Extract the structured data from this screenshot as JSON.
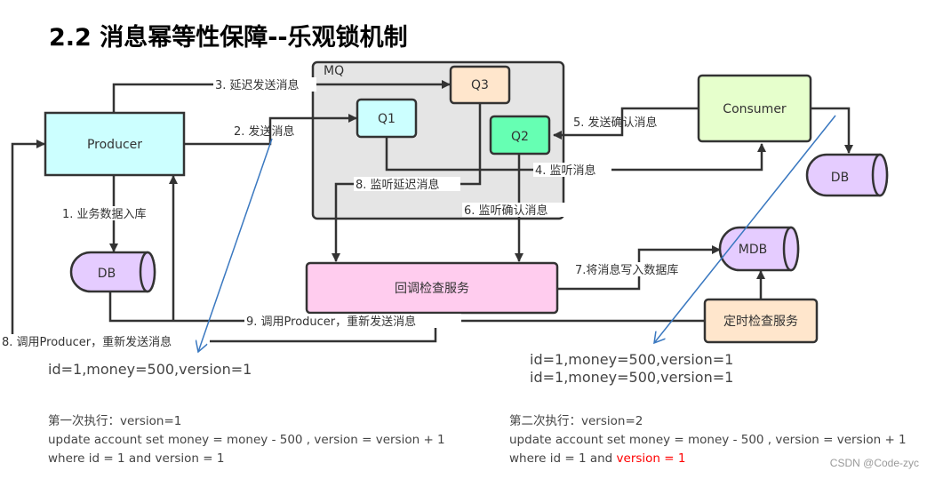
{
  "title": "2.2 消息幂等性保障--乐观锁机制",
  "nodes": {
    "producer": "Producer",
    "consumer": "Consumer",
    "mq": "MQ",
    "q1": "Q1",
    "q2": "Q2",
    "q3": "Q3",
    "db_left": "DB",
    "db_right": "DB",
    "mdb": "MDB",
    "callback_service": "回调检查服务",
    "timer_service": "定时检查服务"
  },
  "edges": {
    "e1": "1. 业务数据入库",
    "e2": "2. 发送消息",
    "e3": "3. 延迟发送消息",
    "e4": "4. 监听消息",
    "e5": "5. 发送确认消息",
    "e6": "6. 监听确认消息",
    "e7": "7.将消息写入数据库",
    "e8a": "8. 监听延迟消息",
    "e8b": "8. 调用Producer，重新发送消息",
    "e9": "9. 调用Producer，重新发送消息"
  },
  "records": {
    "left": [
      "id=1,money=500,version=1"
    ],
    "right": [
      "id=1,money=500,version=1",
      "id=1,money=500,version=1"
    ]
  },
  "executions": {
    "first": {
      "heading": "第一次执行：version=1",
      "line1": "update account set money = money - 500 , version = version + 1",
      "line2_prefix": "where id = 1 and version = 1",
      "line2_highlight": ""
    },
    "second": {
      "heading": "第二次执行：version=2",
      "line1": "update account set money = money - 500 , version = version + 1",
      "line2_prefix": "where id = 1 and ",
      "line2_highlight": "version = 1"
    }
  },
  "colors": {
    "producer": "#ccffff",
    "consumer": "#e6ffcc",
    "mq": "#e5e5e5",
    "q1": "#ccffff",
    "q2": "#66ffb3",
    "q3": "#ffe6cc",
    "db": "#e5ccff",
    "callback": "#ffccee",
    "timer": "#ffe6cc",
    "annotation_line": "#3a78c0",
    "highlight": "#ff0000"
  },
  "watermark": "CSDN @Code-zyc"
}
